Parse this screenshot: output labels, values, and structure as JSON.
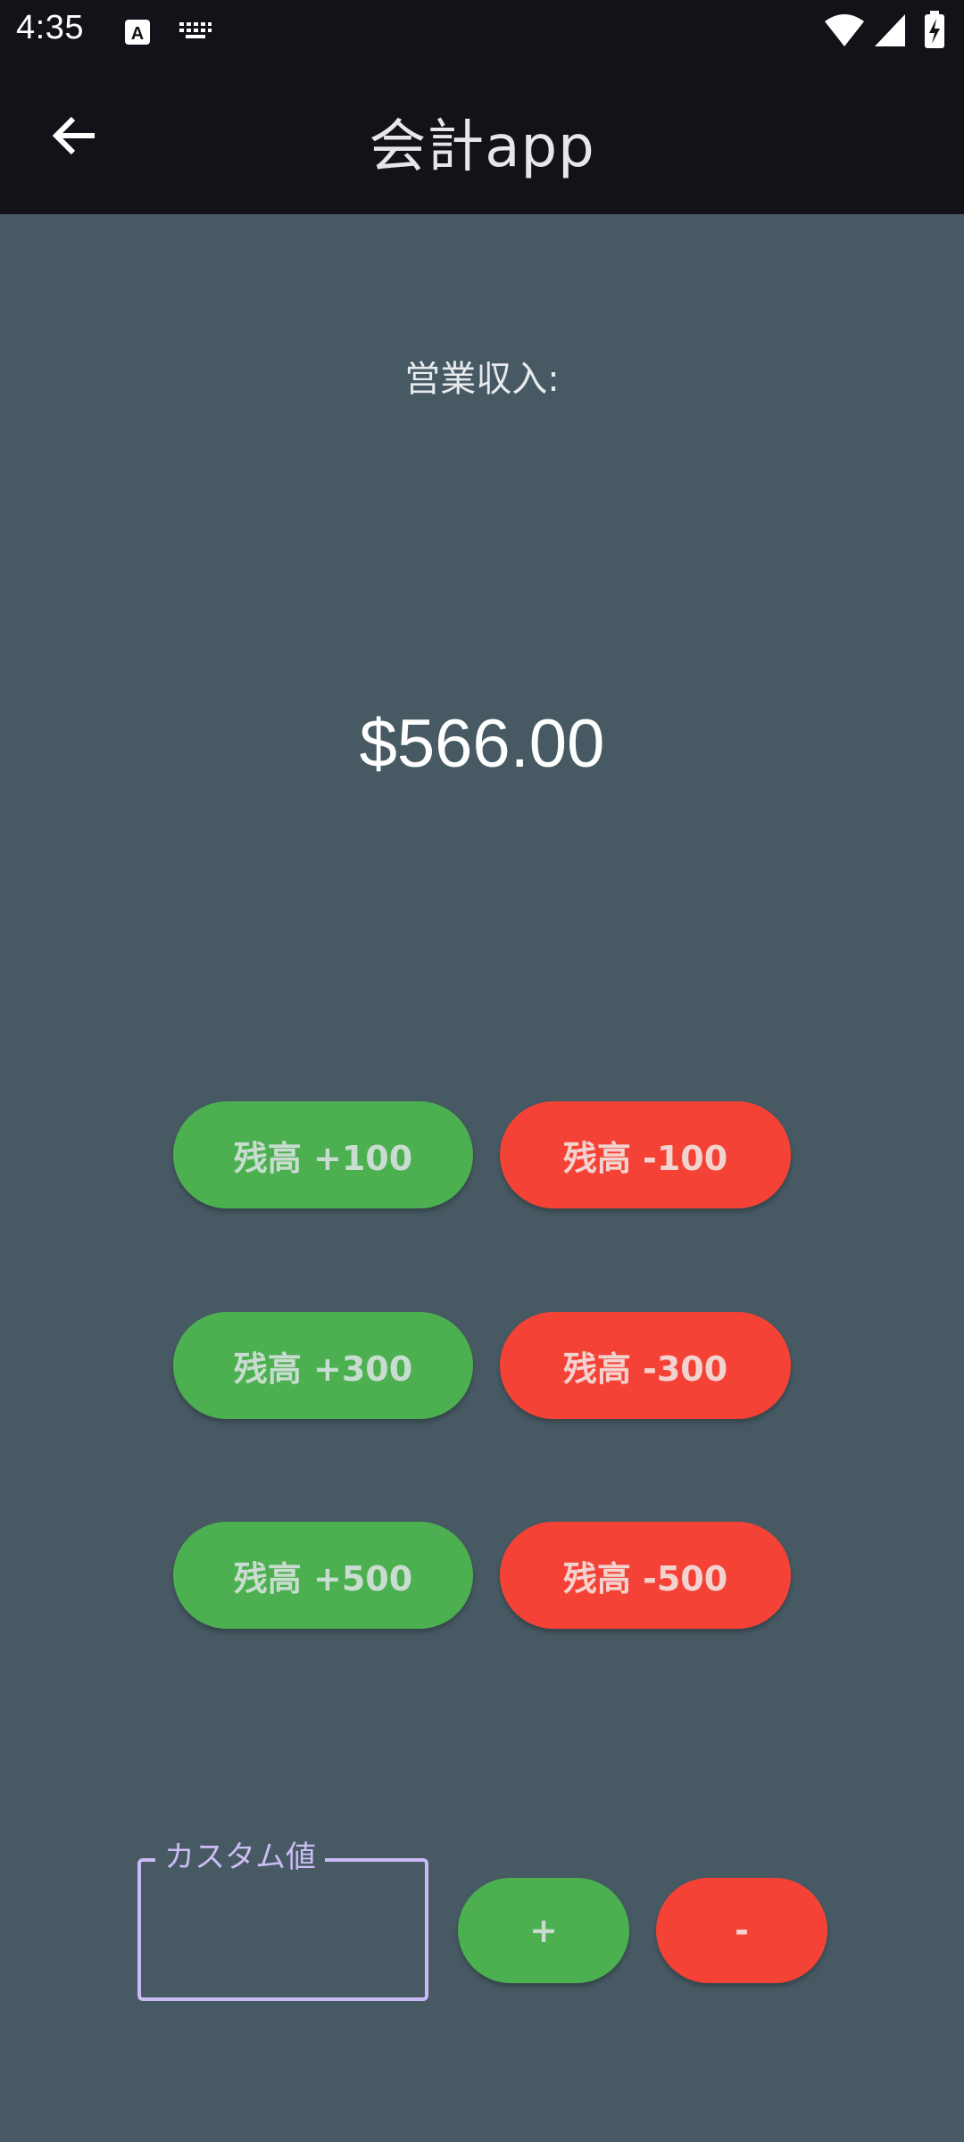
{
  "status_bar": {
    "time": "4:35",
    "icons": [
      "notification-a-icon",
      "keyboard-icon",
      "wifi-icon",
      "signal-icon",
      "battery-icon"
    ]
  },
  "app_bar": {
    "title": "会計app",
    "back_icon": "arrow-back-icon"
  },
  "main": {
    "income_label": "営業収入:",
    "balance": "$566.00",
    "buttons": [
      {
        "label": "残高 +100",
        "kind": "add",
        "amount": 100
      },
      {
        "label": "残高 -100",
        "kind": "subtract",
        "amount": 100
      },
      {
        "label": "残高 +300",
        "kind": "add",
        "amount": 300
      },
      {
        "label": "残高 -300",
        "kind": "subtract",
        "amount": 300
      },
      {
        "label": "残高 +500",
        "kind": "add",
        "amount": 500
      },
      {
        "label": "残高 -500",
        "kind": "subtract",
        "amount": 500
      }
    ],
    "custom": {
      "label": "カスタム値",
      "value": "",
      "plus_label": "+",
      "minus_label": "-"
    }
  },
  "colors": {
    "background": "#475a64",
    "app_bar": "#141218",
    "add_button": "#4caf50",
    "subtract_button": "#f44336",
    "field_outline": "#c9b9f4"
  }
}
